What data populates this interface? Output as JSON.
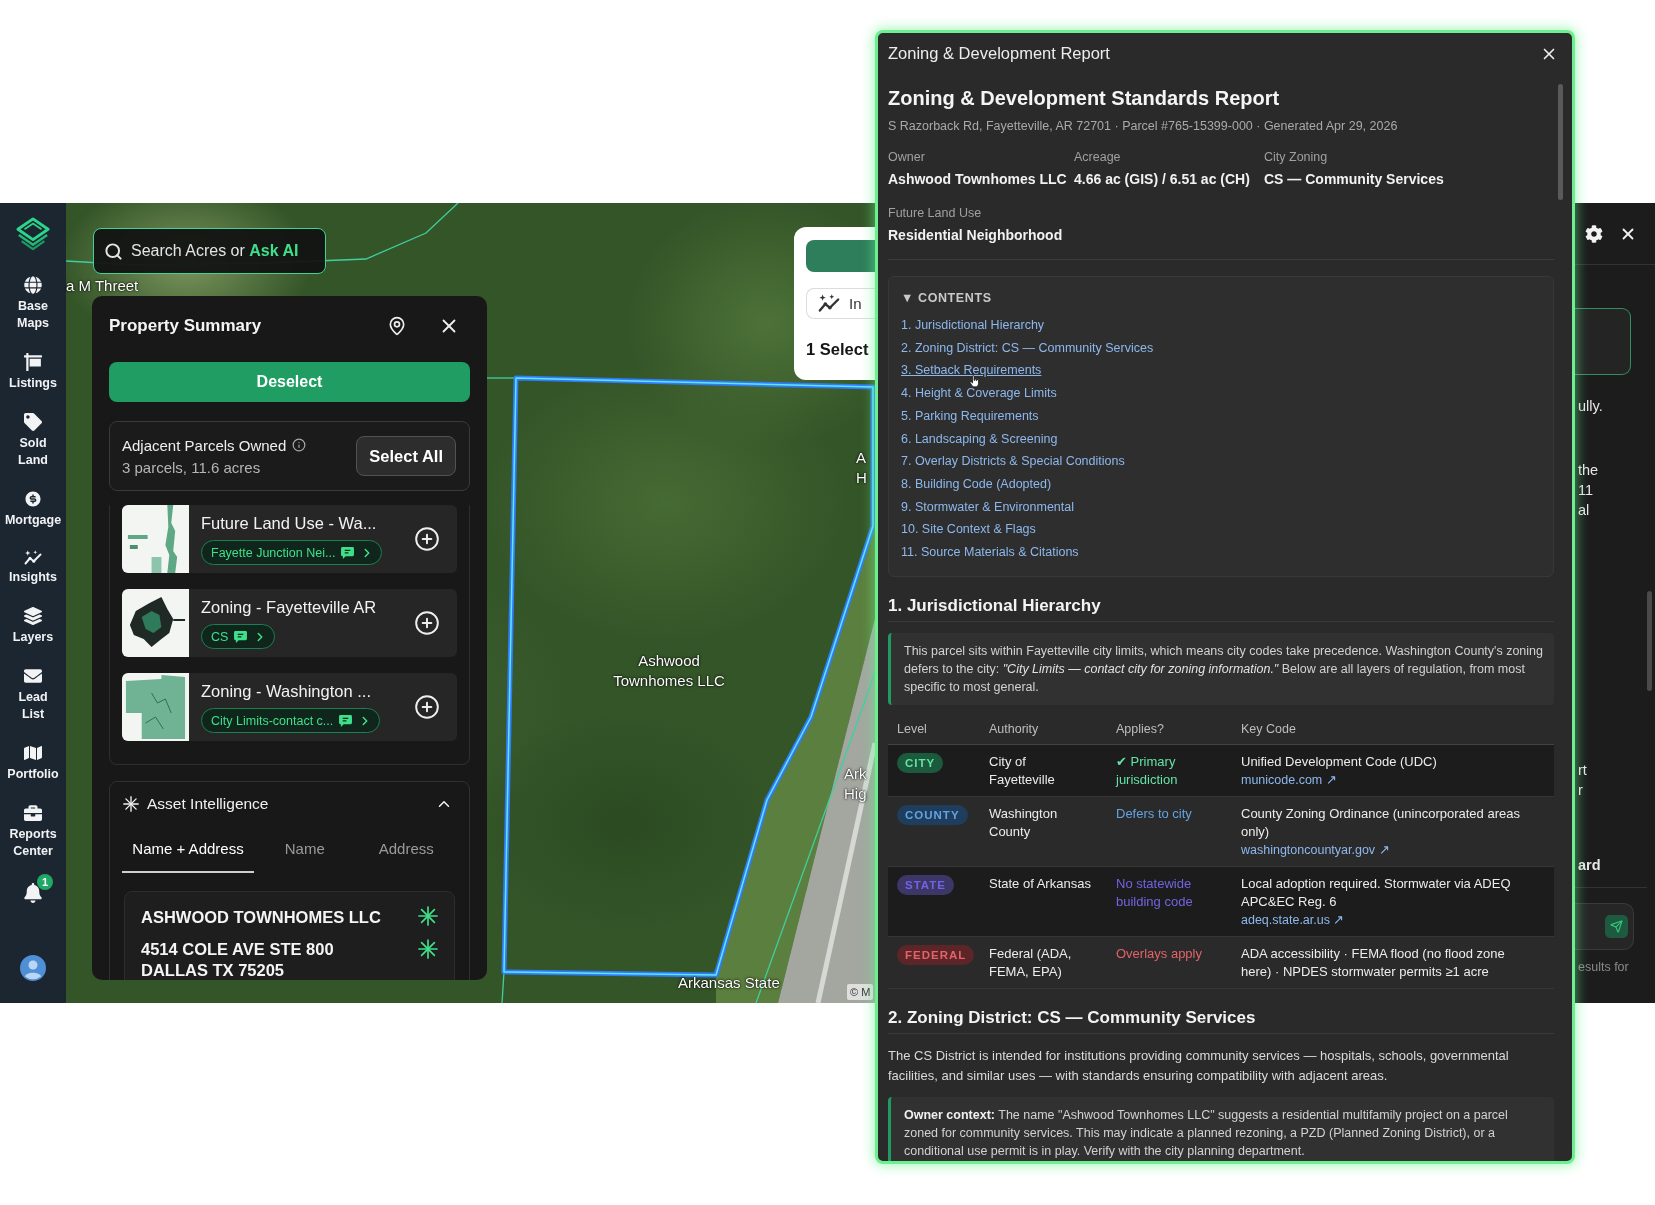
{
  "sidebar": {
    "items": [
      {
        "kind": "globe",
        "label": "Base Maps"
      },
      {
        "kind": "sign",
        "label": "Listings"
      },
      {
        "kind": "tag",
        "label": "Sold Land"
      },
      {
        "kind": "dollar",
        "label": "Mortgage"
      },
      {
        "kind": "insights",
        "label": "Insights"
      },
      {
        "kind": "layers",
        "label": "Layers"
      },
      {
        "kind": "envelope",
        "label": "Lead List"
      },
      {
        "kind": "map",
        "label": "Portfolio"
      },
      {
        "kind": "briefcase",
        "label": "Reports Center"
      }
    ],
    "notification_count": "1"
  },
  "map": {
    "search": {
      "label": "Search Acres or **Ask AI**"
    },
    "labels": [
      "a M Threet",
      "A H",
      "Ashwood Townhomes LLC",
      "Ark Hig",
      "Arkansas State"
    ],
    "attribution": "© M"
  },
  "property_summary": {
    "title": "Property Summary",
    "deselect": "Deselect",
    "adjacent": {
      "title": "Adjacent Parcels Owned",
      "detail": "3 parcels, 11.6 acres",
      "button": "Select All"
    },
    "layers": [
      {
        "kind": "land_use",
        "title": "Future Land Use - Wa...",
        "tag": "Fayette Junction Nei..."
      },
      {
        "kind": "city_zoning",
        "title": "Zoning - Fayetteville AR",
        "tag": "CS"
      },
      {
        "kind": "county_zoning",
        "title": "Zoning - Washington ...",
        "tag": "City Limits-contact c..."
      }
    ],
    "asset_intelligence": {
      "title": "Asset Intelligence",
      "expanded": true,
      "tabs": [
        {
          "label": "Name + Address",
          "selected": true
        },
        {
          "label": "Name",
          "selected": false
        },
        {
          "label": "Address",
          "selected": false
        }
      ],
      "result": {
        "name": "ASHWOOD TOWNHOMES LLC",
        "address_lines": [
          "4514 COLE AVE STE 800",
          "DALLAS TX 75205"
        ]
      }
    }
  },
  "selection_card": {
    "insights_button": "In",
    "selection": "1 Select"
  },
  "report": {
    "window_title": "Zoning & Development Report",
    "title": "Zoning & Development Standards Report",
    "subtitle": "S Razorback Rd, Fayetteville, AR 72701 · Parcel #765-15399-000 · Generated Apr 29, 2026",
    "fields": [
      {
        "label": "Owner",
        "value": "Ashwood Townhomes LLC"
      },
      {
        "label": "Acreage",
        "value": "4.66 ac (GIS) / 6.51 ac (CH)"
      },
      {
        "label": "City Zoning",
        "value": "CS — Community Services"
      },
      {
        "label": "Future Land Use",
        "value": "Residential Neighborhood"
      }
    ],
    "contents": {
      "title": "▼ CONTENTS",
      "items": [
        {
          "label": "1. Jurisdictional Hierarchy",
          "hovered": false
        },
        {
          "label": "2. Zoning District: CS — Community Services",
          "hovered": false
        },
        {
          "label": "3. Setback Requirements",
          "hovered": true
        },
        {
          "label": "4. Height & Coverage Limits",
          "hovered": false
        },
        {
          "label": "5. Parking Requirements",
          "hovered": false
        },
        {
          "label": "6. Landscaping & Screening",
          "hovered": false
        },
        {
          "label": "7. Overlay Districts & Special Conditions",
          "hovered": false
        },
        {
          "label": "8. Building Code (Adopted)",
          "hovered": false
        },
        {
          "label": "9. Stormwater & Environmental",
          "hovered": false
        },
        {
          "label": "10. Site Context & Flags",
          "hovered": false
        },
        {
          "label": "11. Source Materials & Citations",
          "hovered": false
        }
      ]
    },
    "sections": [
      {
        "heading": "1. Jurisdictional Hierarchy",
        "callout": "This parcel sits within Fayetteville city limits, which means city codes take precedence. Washington County's zoning defers to the city: *\"City Limits — contact city for zoning information.\"* Below are all layers of regulation, from most specific to most general.",
        "table": {
          "columns": [
            "Level",
            "Authority",
            "Applies?",
            "Key Code"
          ],
          "rows": [
            {
              "level": "CITY",
              "color": "#1b5a3d",
              "authority": "City of Fayetteville",
              "applies": "✔ Primary jurisdiction",
              "key_code": "Unified Development Code (UDC)",
              "link": "municode.com ↗"
            },
            {
              "level": "COUNTY",
              "color": "#1f3d5c",
              "authority": "Washington County",
              "applies": "Defers to city",
              "key_code": "County Zoning Ordinance (unincorporated areas only)",
              "link": "washingtoncountyar.gov ↗"
            },
            {
              "level": "STATE",
              "color": "#3d3768",
              "authority": "State of Arkansas",
              "applies": "No statewide building code",
              "key_code": "Local adoption required. Stormwater via ADEQ APC&EC Reg. 6",
              "link": "adeq.state.ar.us ↗"
            },
            {
              "level": "FEDERAL",
              "color": "#5c2528",
              "authority": "Federal (ADA, FEMA, EPA)",
              "applies": "Overlays apply",
              "key_code": "ADA accessibility · FEMA flood (no flood zone here) · NPDES stormwater permits ≥1 acre"
            }
          ]
        }
      },
      {
        "heading": "2. Zoning District: CS — Community Services",
        "paragraph": "The CS District is intended for institutions providing community services — hospitals, schools, governmental facilities, and similar uses — with standards ensuring compatibility with adjacent areas.",
        "callout": "**Owner context:** The name \"Ashwood Townhomes LLC\" suggests a residential multifamily project on a parcel zoned for community services. This may indicate a planned rezoning, a PZD (Planned Zoning District), or a conditional use permit is in play. Verify with the city planning department."
      }
    ]
  },
  "chat_panel": {
    "lines": [
      {
        "kind": "body",
        "text": "ully."
      },
      {
        "kind": "body",
        "text": "the"
      },
      {
        "kind": "body",
        "text": "11"
      },
      {
        "kind": "body",
        "text": "al"
      },
      {
        "kind": "body",
        "text": "rt"
      },
      {
        "kind": "body",
        "text": "r"
      },
      {
        "kind": "heading",
        "text": "ard"
      }
    ],
    "footer": "esults for"
  }
}
